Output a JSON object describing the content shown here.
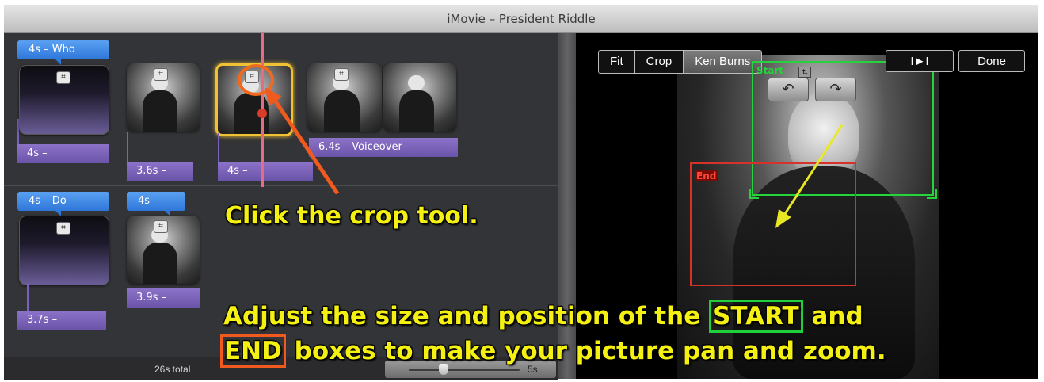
{
  "window": {
    "title": "iMovie – President Riddle"
  },
  "project": {
    "row1": {
      "title_tag": "4s – Who",
      "clips": [
        {
          "label": "4s –"
        },
        {
          "label": "3.6s –"
        },
        {
          "label": "4s –"
        },
        {
          "label": "6.4s – Voiceover"
        }
      ]
    },
    "row2": {
      "title_tag": "4s – Do",
      "second_tag": "4s –",
      "clips": [
        {
          "label": "3.7s –"
        },
        {
          "label": "3.9s –"
        }
      ]
    },
    "crop_badge_glyph": "⌗",
    "total": "26s total",
    "zoom_value": "5s"
  },
  "viewer": {
    "modes": [
      {
        "label": "Fit",
        "active": false
      },
      {
        "label": "Crop",
        "active": false
      },
      {
        "label": "Ken Burns",
        "active": true
      }
    ],
    "play_button": "I►I",
    "done_button": "Done",
    "start_label": "Start",
    "end_label": "End",
    "rotate_left_glyph": "↶",
    "rotate_right_glyph": "↷",
    "swap_glyph": "⇅"
  },
  "annotations": {
    "click_crop": "Click the crop tool.",
    "line2_pre": "Adjust the size and position of the ",
    "line2_start": "START",
    "line2_post": " and",
    "line3_end": "END",
    "line3_post": " boxes to make your picture pan and zoom."
  },
  "colors": {
    "annotation_text": "#f4f011",
    "start_box": "#20d03a",
    "end_box": "#f05a1e",
    "title_tag": "#2f77d9",
    "clip_label": "#6a54a8",
    "selected_clip": "#f0c233",
    "playhead": "#e46c84"
  }
}
